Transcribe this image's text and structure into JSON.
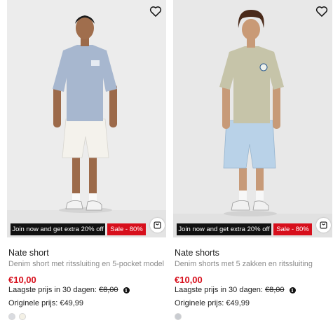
{
  "products": [
    {
      "name": "Nate short",
      "description": "Denim short met ritssluiting en 5-pocket model",
      "price": "€10,00",
      "lowest_label": "Laagste prijs in 30 dagen:",
      "lowest_value": "€8,00",
      "original_label": "Originele prijs:",
      "original_value": "€49,99",
      "promo_join": "Join now and get extra 20% off",
      "promo_sale": "Sale - 80%",
      "wishlist_icon": "heart-outline-icon",
      "cart_icon": "shopping-bag-icon",
      "swatches": [
        {
          "color": "#d9dbe0"
        },
        {
          "color": "#f4f1e6"
        }
      ]
    },
    {
      "name": "Nate shorts",
      "description": "Denim shorts met 5 zakken en ritssluiting",
      "price": "€10,00",
      "lowest_label": "Laagste prijs in 30 dagen:",
      "lowest_value": "€8,00",
      "original_label": "Originele prijs:",
      "original_value": "€49,99",
      "promo_join": "Join now and get extra 20% off",
      "promo_sale": "Sale - 80%",
      "wishlist_icon": "heart-outline-icon",
      "cart_icon": "shopping-bag-icon",
      "swatches": [
        {
          "color": "#c9ccd1"
        }
      ]
    }
  ],
  "colors": {
    "sale_red": "#d70f1c",
    "promo_black": "#111111",
    "photo_background": "#ececec"
  }
}
